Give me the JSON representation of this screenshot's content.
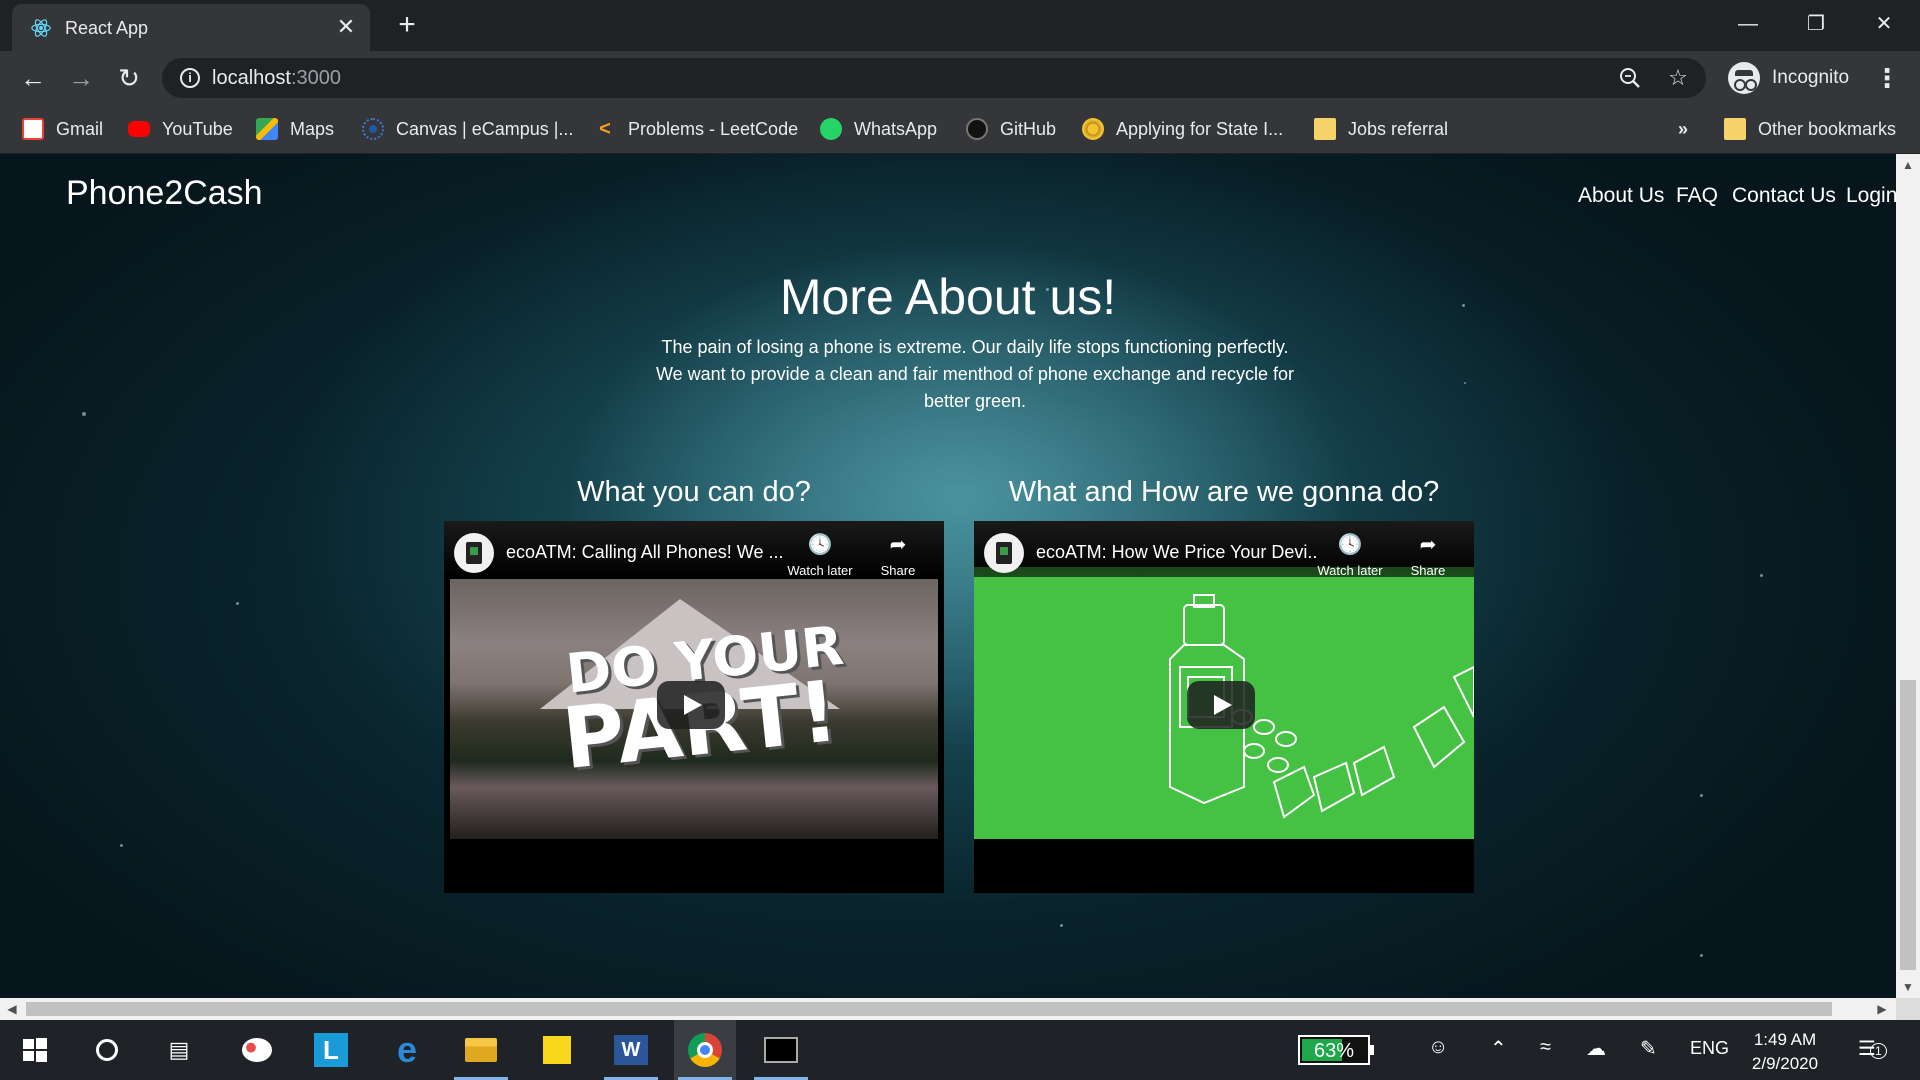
{
  "browser": {
    "tab": {
      "title": "React App",
      "close_glyph": "✕",
      "favicon": "react-icon"
    },
    "new_tab_glyph": "+",
    "window_controls": {
      "minimize": "—",
      "maximize": "❐",
      "close": "✕"
    },
    "address": {
      "host": "localhost",
      "port": ":3000"
    },
    "profile_label": "Incognito",
    "bookmarks": [
      {
        "label": "Gmail",
        "icon": "gmail-icon",
        "color": "#ea4335"
      },
      {
        "label": "YouTube",
        "icon": "youtube-icon",
        "color": "#ff0000"
      },
      {
        "label": "Maps",
        "icon": "maps-icon",
        "color": "#34a853"
      },
      {
        "label": "Canvas | eCampus |...",
        "icon": "canvas-icon",
        "color": "#1e5aa8"
      },
      {
        "label": "Problems - LeetCode",
        "icon": "leetcode-icon",
        "color": "#f89f1b"
      },
      {
        "label": "WhatsApp",
        "icon": "whatsapp-icon",
        "color": "#25d366"
      },
      {
        "label": "GitHub",
        "icon": "github-icon",
        "color": "#444444"
      },
      {
        "label": "Applying for State I...",
        "icon": "state-seal-icon",
        "color": "#f2c230"
      },
      {
        "label": "Jobs referral",
        "icon": "folder-icon",
        "color": "#f6d36b"
      }
    ],
    "bookmarks_overflow": "»",
    "other_bookmarks": "Other bookmarks"
  },
  "page": {
    "brand": "Phone2Cash",
    "nav": [
      "About Us",
      "FAQ",
      "Contact Us",
      "Login"
    ],
    "about_title": "More About us!",
    "about_text_lines": [
      "The pain of losing a phone is extreme. Our daily life stops functioning perfectly.",
      "We want to provide a clean and fair menthod of phone exchange and recycle for",
      "better green."
    ],
    "columns": [
      {
        "heading": "What you can do?",
        "video_title": "ecoATM: Calling All Phones! We ...",
        "watch_later": "Watch later",
        "share": "Share",
        "thumb_text_line1": "DO YOUR",
        "thumb_text_line2": "PART!"
      },
      {
        "heading": "What and How are we gonna do?",
        "video_title": "ecoATM: How We Price Your Devi...",
        "watch_later": "Watch later",
        "share": "Share",
        "thumb_color": "#45c144"
      }
    ]
  },
  "taskbar": {
    "battery_percent": 63,
    "battery_label": "63%",
    "language": "ENG",
    "time": "1:49 AM",
    "date": "2/9/2020",
    "notification_count": "1",
    "apps": [
      "windows-start-icon",
      "cortana-icon",
      "task-view-icon",
      "paint-icon",
      "l-app-icon",
      "edge-icon",
      "file-explorer-icon",
      "sticky-notes-icon",
      "word-icon",
      "chrome-icon",
      "terminal-icon"
    ]
  }
}
